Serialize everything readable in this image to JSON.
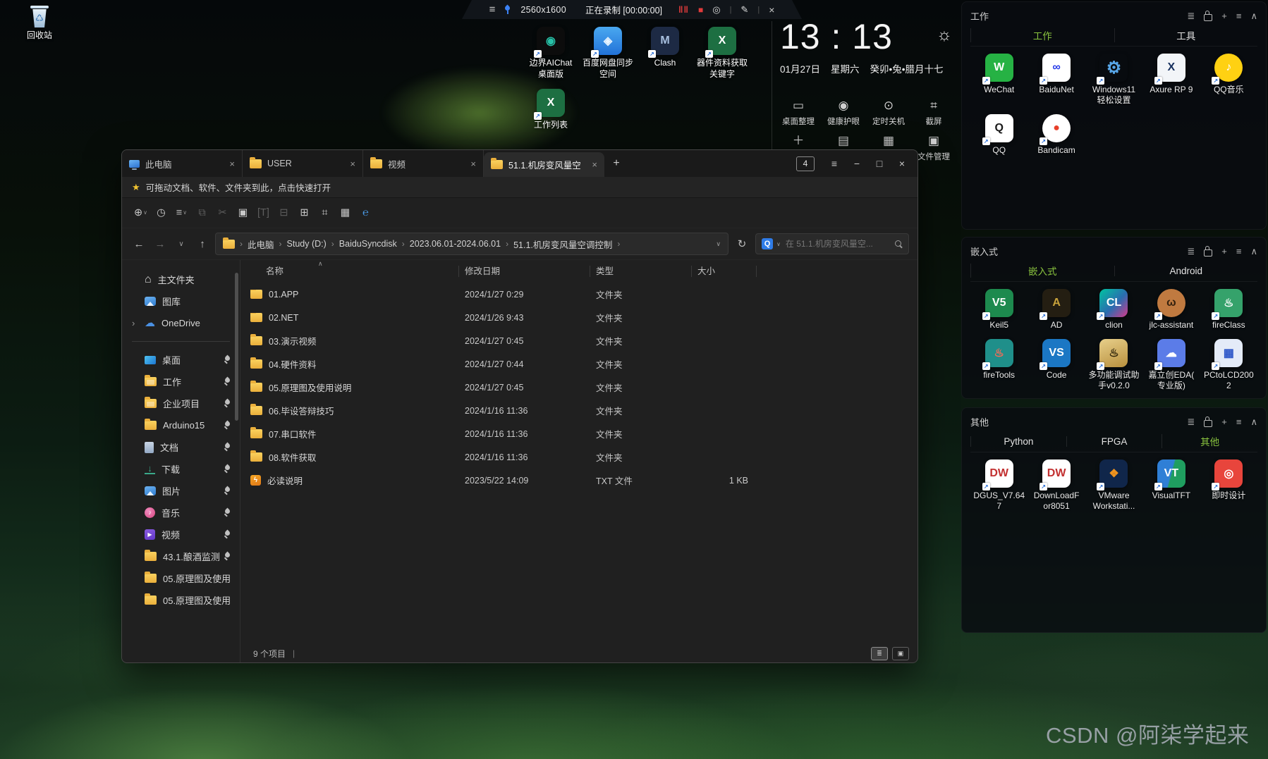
{
  "recording_bar": {
    "menu": "≡",
    "resolution": "2560x1600",
    "status": "正在录制 [00:00:00]",
    "pause": "‖‖",
    "stop": "■",
    "camera": "◎",
    "pencil": "✎",
    "close": "×",
    "divider": "|"
  },
  "clock": {
    "time": "13 : 13",
    "sun": "☼",
    "date": "01月27日",
    "weekday": "星期六",
    "lunar": "癸卯•兔•腊月十七"
  },
  "widget_tools": [
    {
      "glyph": "▭",
      "label": "桌面整理"
    },
    {
      "glyph": "◉",
      "label": "健康护眼"
    },
    {
      "glyph": "⊙",
      "label": "定时关机"
    },
    {
      "glyph": "⌗",
      "label": "截屏"
    },
    {
      "glyph": "＋",
      "label": ""
    },
    {
      "glyph": "▤",
      "label": ""
    },
    {
      "glyph": "▦",
      "label": ""
    },
    {
      "glyph": "▣",
      "label": "文件管理"
    }
  ],
  "recycle_bin": {
    "label": "回收站",
    "glyph": "♺"
  },
  "desktop_icons": [
    {
      "label": "边界AIChat\n桌面版",
      "abbr": "◉",
      "bg": "#0c0c0c",
      "fg": "#27c2a8"
    },
    {
      "label": "百度网盘同步\n空间",
      "abbr": "◈",
      "bg": "linear-gradient(180deg,#4aa8f0,#2272d8)",
      "fg": "#e8f4ff"
    },
    {
      "label": "Clash",
      "abbr": "M",
      "bg": "#1d2a44",
      "fg": "#a8c0e0"
    },
    {
      "label": "工作列表",
      "abbr": "X",
      "bg": "#1d6f42",
      "fg": "#ffffff"
    },
    {
      "label": "器件资料获取\n关键字",
      "abbr": "X",
      "bg": "#1d6f42",
      "fg": "#ffffff"
    }
  ],
  "icons": {
    "shortcut_arrow": "↗"
  },
  "header_icons": {
    "list": "≣",
    "plus": "+",
    "menu": "≡",
    "collapse": "∧"
  },
  "panels": [
    {
      "title": "工作",
      "tabs": [
        {
          "label": "工作",
          "active": true
        },
        {
          "label": "工具"
        }
      ],
      "items": [
        {
          "label": "WeChat",
          "abbr": "W",
          "bg": "#26b244",
          "fg": "#ffffff"
        },
        {
          "label": "BaiduNet",
          "abbr": "∞",
          "bg": "#ffffff",
          "fg": "#2438e8"
        },
        {
          "label": "Windows11\n轻松设置",
          "abbr": "⚙",
          "bg": "transparent",
          "fg": "#58a6e8",
          "big": true
        },
        {
          "label": "Axure RP 9",
          "abbr": "X",
          "bg": "#f2f5f8",
          "fg": "#16305e"
        },
        {
          "label": "QQ音乐",
          "abbr": "♪",
          "bg": "#ffd112",
          "fg": "#ffffff",
          "shape": "circle"
        },
        {
          "label": "QQ",
          "abbr": "Q",
          "bg": "#ffffff",
          "fg": "#1a1a1a"
        },
        {
          "label": "Bandicam",
          "abbr": "●",
          "bg": "#ffffff",
          "fg": "#e8402a",
          "shape": "circle"
        }
      ]
    },
    {
      "title": "嵌入式",
      "tabs": [
        {
          "label": "嵌入式",
          "active": true
        },
        {
          "label": "Android"
        }
      ],
      "items": [
        {
          "label": "Keil5",
          "abbr": "V5",
          "bg": "#1d8a4e",
          "fg": "#ffffff"
        },
        {
          "label": "AD",
          "abbr": "A",
          "bg": "#241e12",
          "fg": "#c9a33b"
        },
        {
          "label": "clion",
          "abbr": "CL",
          "bg": "linear-gradient(135deg,#00c4a0,#2b6cb0 55%,#d43a8c)",
          "fg": "#ffffff"
        },
        {
          "label": "jlc-assistant",
          "abbr": "ω",
          "bg": "#c07a40",
          "fg": "#33200e",
          "shape": "circle"
        },
        {
          "label": "fireClass",
          "abbr": "♨",
          "bg": "#35a26b",
          "fg": "#ffffff"
        },
        {
          "label": "fireTools",
          "abbr": "♨",
          "bg": "#1f8f8a",
          "fg": "#ff6a55"
        },
        {
          "label": "Code",
          "abbr": "VS",
          "bg": "#1b77c4",
          "fg": "#ffffff"
        },
        {
          "label": "多功能调试助\n手v0.2.0",
          "abbr": "♨",
          "bg": "linear-gradient(160deg,#e7cf8a,#b9903e)",
          "fg": "#2a2008"
        },
        {
          "label": "嘉立创EDA(\n专业版)",
          "abbr": "☁",
          "bg": "#5b7ce8",
          "fg": "#ffffff"
        },
        {
          "label": "PCtoLCD200\n2",
          "abbr": "▦",
          "bg": "#e4ebf8",
          "fg": "#2b55c8"
        }
      ]
    },
    {
      "title": "其他",
      "tabs": [
        {
          "label": "Python"
        },
        {
          "label": "FPGA"
        },
        {
          "label": "其他",
          "active": true
        }
      ],
      "items": [
        {
          "label": "DGUS_V7.64\n7",
          "abbr": "DW",
          "bg": "#ffffff",
          "fg": "#c23030"
        },
        {
          "label": "DownLoadF\nor8051",
          "abbr": "DW",
          "bg": "#ffffff",
          "fg": "#c23030"
        },
        {
          "label": "VMware\nWorkstati...",
          "abbr": "❖",
          "bg": "#10264a",
          "fg": "#f0941e"
        },
        {
          "label": "VisualTFT",
          "abbr": "VT",
          "bg": "linear-gradient(105deg,#2f7fd6 48%,#1f9e5f 52%)",
          "fg": "#ffffff"
        },
        {
          "label": "即时设计",
          "abbr": "◎",
          "bg": "#e8453c",
          "fg": "#ffffff"
        }
      ]
    }
  ],
  "window": {
    "tabs": [
      {
        "label": "此电脑",
        "icon": "ic-pc"
      },
      {
        "label": "USER",
        "icon": "ic-folder"
      },
      {
        "label": "视频",
        "icon": "ic-folder"
      },
      {
        "label": "51.1.机房变风量空",
        "icon": "ic-folder",
        "active": true
      }
    ],
    "tab_close": "×",
    "new_tab": "+",
    "counter": "4",
    "min": "−",
    "max": "□",
    "close": "×",
    "menu": "≡",
    "quickbar": {
      "star": "★",
      "text": "可拖动文档、软件、文件夹到此，点击快速打开"
    },
    "toolbar": [
      {
        "name": "new",
        "glyph": "⊕",
        "chevron": true
      },
      {
        "name": "recent",
        "glyph": "◷"
      },
      {
        "name": "view-options",
        "glyph": "≡",
        "chevron": true
      },
      {
        "name": "copy",
        "glyph": "⧉",
        "dim": true
      },
      {
        "name": "cut",
        "glyph": "✂",
        "dim": true
      },
      {
        "name": "paste",
        "glyph": "▣"
      },
      {
        "name": "rename",
        "glyph": "[T]",
        "dim": true
      },
      {
        "name": "delete",
        "glyph": "⊟",
        "dim": true
      },
      {
        "name": "new-folder",
        "glyph": "⊞"
      },
      {
        "name": "screenshot",
        "glyph": "⌗"
      },
      {
        "name": "calculator",
        "glyph": "▦"
      },
      {
        "name": "refresh",
        "glyph": "℮",
        "color": "#4a9be8"
      }
    ],
    "addressbar": {
      "back": "←",
      "forward": "→",
      "down": "∨",
      "up": "↑",
      "sep": "›",
      "dropdown": "∨",
      "refresh": "↻",
      "crumbs": [
        "此电脑",
        "Study (D:)",
        "BaiduSyncdisk",
        "2023.06.01-2024.06.01",
        "51.1.机房变风量空调控制"
      ]
    },
    "search": {
      "engine": "Q",
      "dropdown": "∨",
      "placeholder": "在 51.1.机房变风量空..."
    },
    "sidebar": {
      "top": [
        {
          "label": "主文件夹",
          "type": "ic-home"
        },
        {
          "label": "图库",
          "type": "ic-gallery"
        },
        {
          "label": "OneDrive",
          "type": "ic-cloud",
          "expand": "›"
        }
      ],
      "pinned": [
        {
          "label": "桌面",
          "type": "ic-desktop",
          "pinned": true
        },
        {
          "label": "工作",
          "type": "ic-folder-badge",
          "pinned": true
        },
        {
          "label": "企业项目",
          "type": "ic-folder-badge",
          "pinned": true
        },
        {
          "label": "Arduino15",
          "type": "ic-folder",
          "pinned": true
        },
        {
          "label": "文档",
          "type": "ic-doc",
          "pinned": true
        },
        {
          "label": "下载",
          "type": "ic-download",
          "pinned": true
        },
        {
          "label": "图片",
          "type": "ic-picture",
          "pinned": true
        },
        {
          "label": "音乐",
          "type": "ic-music",
          "pinned": true
        },
        {
          "label": "视频",
          "type": "ic-video",
          "pinned": true
        },
        {
          "label": "43.1.酿酒监测",
          "type": "ic-folder",
          "pinned": true
        },
        {
          "label": "05.原理图及使用",
          "type": "ic-folder"
        },
        {
          "label": "05.原理图及使用",
          "type": "ic-folder"
        }
      ]
    },
    "sort_caret": "∧",
    "columns": [
      "名称",
      "修改日期",
      "类型",
      "大小"
    ],
    "files": [
      {
        "name": "01.APP",
        "date": "2024/1/27 0:29",
        "type": "文件夹",
        "size": "",
        "icon": "ic-folder"
      },
      {
        "name": "02.NET",
        "date": "2024/1/26 9:43",
        "type": "文件夹",
        "size": "",
        "icon": "ic-folder"
      },
      {
        "name": "03.演示视频",
        "date": "2024/1/27 0:45",
        "type": "文件夹",
        "size": "",
        "icon": "ic-folder"
      },
      {
        "name": "04.硬件资料",
        "date": "2024/1/27 0:44",
        "type": "文件夹",
        "size": "",
        "icon": "ic-folder"
      },
      {
        "name": "05.原理图及使用说明",
        "date": "2024/1/27 0:45",
        "type": "文件夹",
        "size": "",
        "icon": "ic-folder"
      },
      {
        "name": "06.毕设答辩技巧",
        "date": "2024/1/16 11:36",
        "type": "文件夹",
        "size": "",
        "icon": "ic-folder"
      },
      {
        "name": "07.串口软件",
        "date": "2024/1/16 11:36",
        "type": "文件夹",
        "size": "",
        "icon": "ic-folder"
      },
      {
        "name": "08.软件获取",
        "date": "2024/1/16 11:36",
        "type": "文件夹",
        "size": "",
        "icon": "ic-folder"
      },
      {
        "name": "必读说明",
        "date": "2023/5/22 14:09",
        "type": "TXT 文件",
        "size": "1 KB",
        "icon": "ic-txt"
      }
    ],
    "status": {
      "count": "9 个项目",
      "cursor": "|",
      "view_list": "≣",
      "view_thumb": "▣"
    }
  },
  "watermark": "CSDN @阿柒学起来",
  "colors": {
    "accent_green": "#8ac43f",
    "folder_yellow": "#f2c24b",
    "record_red": "#e23b3b",
    "search_blue": "#2f7ce8"
  }
}
